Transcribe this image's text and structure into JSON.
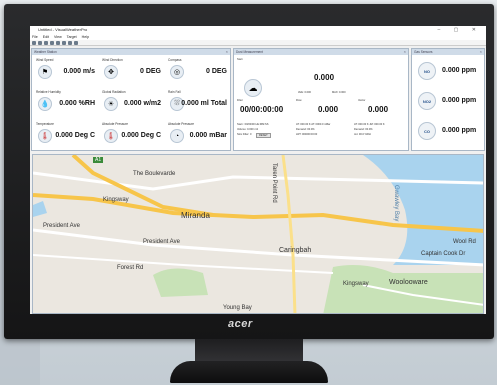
{
  "monitor": {
    "brand": "acer"
  },
  "app": {
    "title": "Untitled - VisualWeatherPro",
    "menu": [
      "File",
      "Edit",
      "View",
      "Target",
      "Help"
    ],
    "window_controls": "–  ▢  ✕"
  },
  "weather_panel": {
    "title": "Weather Station",
    "cells": [
      {
        "label": "Wind Speed",
        "value": "0.000 m/s",
        "icon": "wind-flag-icon"
      },
      {
        "label": "Wind Direction",
        "value": "0 DEG",
        "icon": "compass-icon"
      },
      {
        "label": "Compass",
        "value": "0 DEG",
        "icon": "compass-icon"
      },
      {
        "label": "Relative Humidity",
        "value": "0.000 %RH",
        "icon": "humidity-icon"
      },
      {
        "label": "Global Radiation",
        "value": "0.000 w/m2",
        "icon": "sun-icon"
      },
      {
        "label": "Rain Fall",
        "value": "0.000 ml Total",
        "icon": "rain-gauge-icon"
      },
      {
        "label": "Temperature",
        "value": "0.000 Deg C",
        "icon": "thermometer-icon"
      },
      {
        "label": "Absolute Pressure",
        "value": "0.000 Deg C",
        "icon": "thermometer-icon"
      },
      {
        "label": "Absolute Pressure",
        "value": "0.000 mBar",
        "icon": "gauge-icon"
      }
    ]
  },
  "particle_panel": {
    "title": "Dust Measurement",
    "main_value": "0.000",
    "timer": "00/00:00:00",
    "flow_value": "0.000",
    "vector_value": "0.000",
    "row_labels": [
      "Start",
      "Filter",
      "Flow",
      "Vector"
    ],
    "small_a": "AVE: 0.000",
    "small_b": "MAX: 0.000",
    "info_left": [
      "Start : 00/00/00 HH:MM:SS",
      "Volume: 0.000 m3",
      "Size Filter: 0"
    ],
    "info_mid": [
      "AT: 000.00 K   AT: 0000.0 mBar",
      "Demand: 00.0%",
      "LRT: 000/00:00:00"
    ],
    "info_right": [
      "AT: 000.00 K   JM: 000.00 K",
      "Demand: 00.0%",
      "Jet: 00.0 %RH"
    ],
    "button": "RESET"
  },
  "gas_panel": {
    "title": "Gas Sensors",
    "items": [
      {
        "gas": "NO",
        "value": "0.000 ppm"
      },
      {
        "gas": "NO2",
        "value": "0.000 ppm"
      },
      {
        "gas": "CO",
        "value": "0.000 ppm"
      }
    ]
  },
  "map": {
    "labels": [
      "The Boulevarde",
      "Kingsway",
      "Miranda",
      "President Ave",
      "President Ave",
      "Caringbah",
      "Captain Cook Dr",
      "Woolooware",
      "Forest Rd",
      "Taren Point Rd",
      "Gwawley Bay",
      "Kingsway",
      "Wool Rd",
      "Young Bay",
      "A1"
    ]
  },
  "colors": {
    "panel_header": "#cfdbe8",
    "highway": "#f7c54a",
    "water": "#a9d3ee",
    "park": "#c8e2b7"
  }
}
